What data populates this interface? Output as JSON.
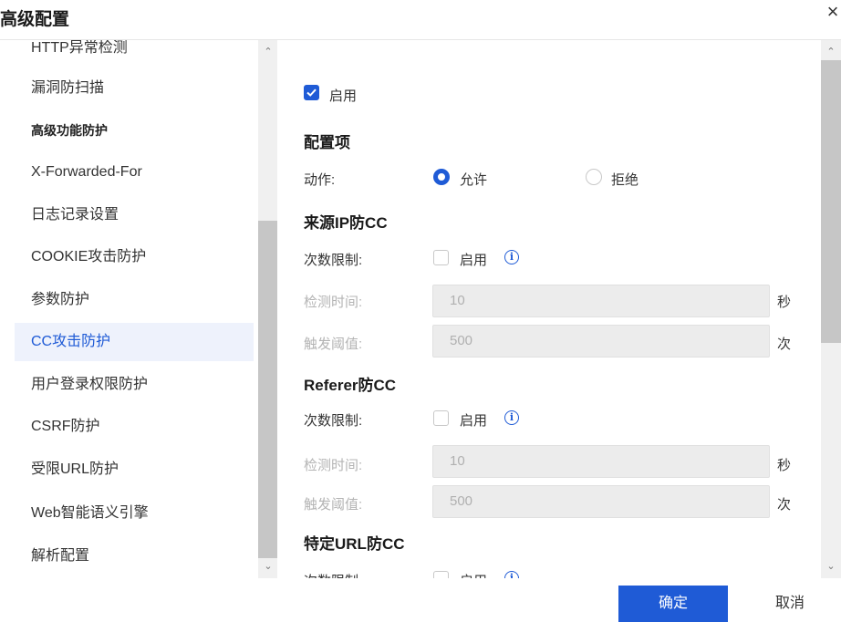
{
  "dialog": {
    "title": "高级配置",
    "close_glyph": "×"
  },
  "sidebar": {
    "items": [
      {
        "label": "HTTP异常检测",
        "type": "item"
      },
      {
        "label": "漏洞防扫描",
        "type": "item"
      },
      {
        "label": "高级功能防护",
        "type": "group"
      },
      {
        "label": "X-Forwarded-For",
        "type": "item"
      },
      {
        "label": "日志记录设置",
        "type": "item"
      },
      {
        "label": "COOKIE攻击防护",
        "type": "item"
      },
      {
        "label": "参数防护",
        "type": "item"
      },
      {
        "label": "CC攻击防护",
        "type": "item",
        "active": true
      },
      {
        "label": "用户登录权限防护",
        "type": "item"
      },
      {
        "label": "CSRF防护",
        "type": "item"
      },
      {
        "label": "受限URL防护",
        "type": "item"
      },
      {
        "label": "Web智能语义引擎",
        "type": "item"
      },
      {
        "label": "解析配置",
        "type": "item"
      }
    ]
  },
  "content": {
    "enable": {
      "label": "启用",
      "checked": true
    },
    "config_section": "配置项",
    "action": {
      "label": "动作:",
      "options": [
        "允许",
        "拒绝"
      ],
      "selected": "允许"
    },
    "source_ip": {
      "title": "来源IP防CC",
      "limit_label": "次数限制:",
      "limit_enable": "启用",
      "limit_checked": false,
      "detect_label": "检测时间:",
      "detect_value": "10",
      "detect_unit": "秒",
      "trigger_label": "触发阈值:",
      "trigger_value": "500",
      "trigger_unit": "次"
    },
    "referer": {
      "title": "Referer防CC",
      "limit_label": "次数限制:",
      "limit_enable": "启用",
      "limit_checked": false,
      "detect_label": "检测时间:",
      "detect_value": "10",
      "detect_unit": "秒",
      "trigger_label": "触发阈值:",
      "trigger_value": "500",
      "trigger_unit": "次"
    },
    "specific_url": {
      "title": "特定URL防CC",
      "limit_label": "次数限制:",
      "limit_enable": "启用"
    }
  },
  "footer": {
    "ok": "确定",
    "cancel": "取消"
  },
  "colors": {
    "accent": "#1f5bd6",
    "active_bg": "#eef2fc",
    "field_bg": "#ececec"
  }
}
